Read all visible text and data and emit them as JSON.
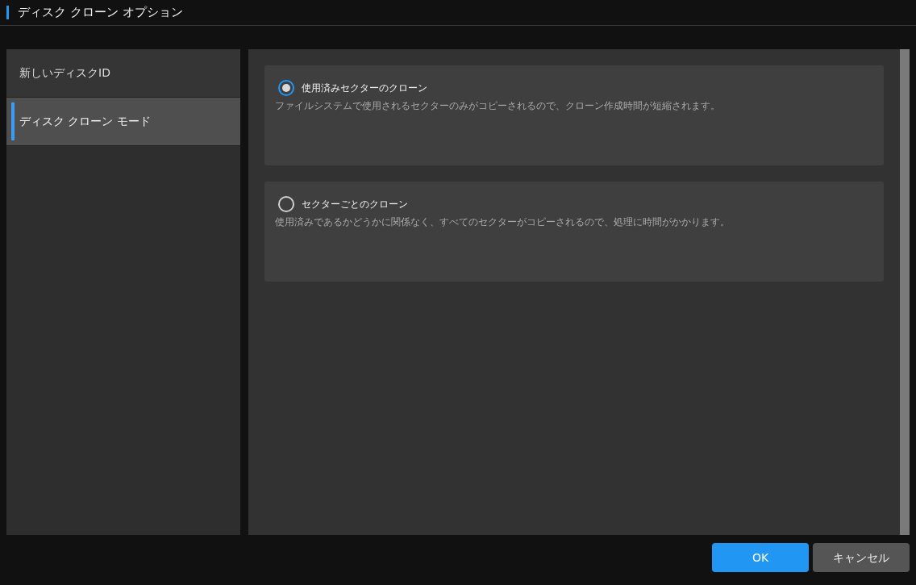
{
  "window": {
    "title": "ディスク クローン オプション"
  },
  "sidebar": {
    "items": [
      {
        "label": "新しいディスクID",
        "selected": false
      },
      {
        "label": "ディスク クローン モード",
        "selected": true
      }
    ]
  },
  "options": [
    {
      "title": "使用済みセクターのクローン",
      "description": "ファイルシステムで使用されるセクターのみがコピーされるので、クローン作成時間が短縮されます。",
      "selected": true
    },
    {
      "title": "セクターごとのクローン",
      "description": "使用済みであるかどうかに関係なく、すべてのセクターがコピーされるので、処理に時間がかかります。",
      "selected": false
    }
  ],
  "buttons": {
    "ok": "OK",
    "cancel": "キャンセル"
  }
}
